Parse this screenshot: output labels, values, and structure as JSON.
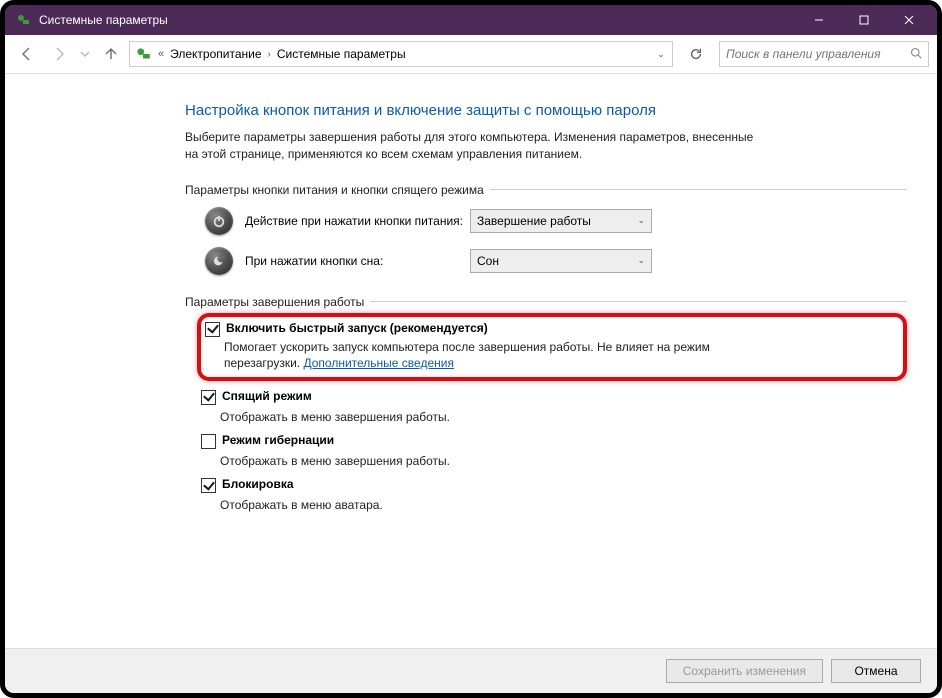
{
  "window": {
    "title": "Системные параметры"
  },
  "breadcrumb": {
    "item1": "Электропитание",
    "item2": "Системные параметры"
  },
  "search": {
    "placeholder": "Поиск в панели управления"
  },
  "page": {
    "heading": "Настройка кнопок питания и включение защиты с помощью пароля",
    "intro": "Выберите параметры завершения работы для этого компьютера. Изменения параметров, внесенные на этой странице, применяются ко всем схемам управления питанием."
  },
  "section1": {
    "legend": "Параметры кнопки питания и кнопки спящего режима",
    "power_label": "Действие при нажатии кнопки питания:",
    "power_value": "Завершение работы",
    "sleep_label": "При нажатии кнопки сна:",
    "sleep_value": "Сон"
  },
  "section2": {
    "legend": "Параметры завершения работы",
    "fast_startup": {
      "checked": true,
      "label": "Включить быстрый запуск (рекомендуется)",
      "desc_pre": "Помогает ускорить запуск компьютера после завершения работы. Не влияет на режим перезагрузки. ",
      "link": "Дополнительные сведения"
    },
    "sleep": {
      "checked": true,
      "label": "Спящий режим",
      "desc": "Отображать в меню завершения работы."
    },
    "hibernate": {
      "checked": false,
      "label": "Режим гибернации",
      "desc": "Отображать в меню завершения работы."
    },
    "lock": {
      "checked": true,
      "label": "Блокировка",
      "desc": "Отображать в меню аватара."
    }
  },
  "footer": {
    "save": "Сохранить изменения",
    "cancel": "Отмена"
  }
}
